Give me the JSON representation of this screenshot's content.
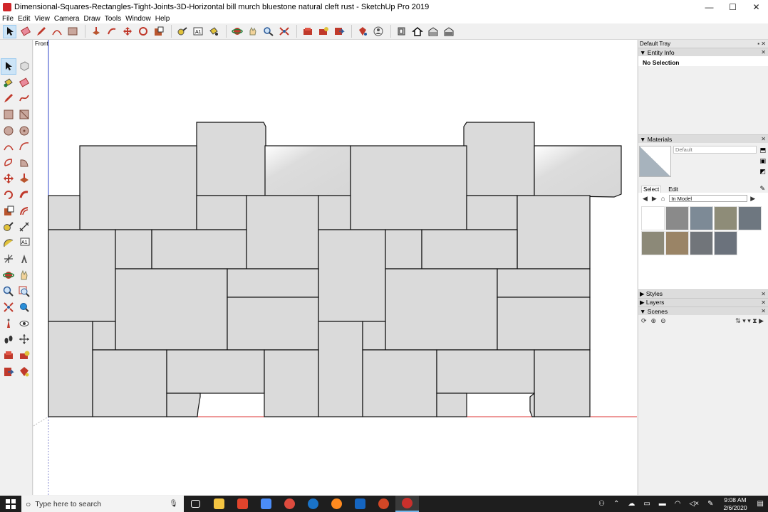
{
  "window": {
    "title": "Dimensional-Squares-Rectangles-Tight-Joints-3D-Horizontal bill murch bluestone natural cleft rust - SketchUp Pro 2019",
    "minimize": "—",
    "maximize": "☐",
    "close": "✕"
  },
  "menu": [
    "File",
    "Edit",
    "View",
    "Camera",
    "Draw",
    "Tools",
    "Window",
    "Help"
  ],
  "toolbar_icons": [
    "select-icon",
    "eraser-icon",
    "pencil-icon",
    "arc-icon",
    "rectangle-icon",
    "push-pull-icon",
    "follow-me-icon",
    "move-icon",
    "rotate-icon",
    "scale-icon",
    "tape-measure-icon",
    "text-icon",
    "paint-bucket-icon",
    "orbit-icon",
    "pan-icon",
    "zoom-icon",
    "zoom-extents-icon",
    "warehouse-icon",
    "extension-icon",
    "send-icon",
    "ruby-icon",
    "account-icon",
    "top-view-icon",
    "home-view-icon",
    "front-view-icon",
    "right-view-icon"
  ],
  "viewport": {
    "scene_label": "Front"
  },
  "tray": {
    "title": "Default Tray",
    "entity_info": {
      "title": "Entity Info",
      "status": "No Selection"
    },
    "materials": {
      "title": "Materials",
      "current_name": "Default",
      "tabs": [
        "Select",
        "Edit"
      ],
      "collection": "In Model",
      "swatch_colors": [
        "#ffffff",
        "#8a8a8a",
        "#7d8a96",
        "#8e8c78",
        "#6e7780",
        "#8c8978",
        "#9a8466",
        "#71757a",
        "#6b727c"
      ]
    },
    "styles": {
      "title": "Styles"
    },
    "layers": {
      "title": "Layers"
    },
    "scenes": {
      "title": "Scenes"
    }
  },
  "taskbar": {
    "search_placeholder": "Type here to search",
    "time": "9:08 AM",
    "date": "2/6/2020",
    "apps": [
      {
        "name": "task-view",
        "color": "#ffffff"
      },
      {
        "name": "file-explorer",
        "color": "#f4c542"
      },
      {
        "name": "sketchup-red",
        "color": "#e0442c"
      },
      {
        "name": "drive",
        "color": "#4b8df8"
      },
      {
        "name": "chrome",
        "color": "#dd4b3e"
      },
      {
        "name": "edge",
        "color": "#1a73c8"
      },
      {
        "name": "firefox",
        "color": "#ff8a1f"
      },
      {
        "name": "outlook",
        "color": "#1565c0"
      },
      {
        "name": "powerpoint",
        "color": "#d24726"
      },
      {
        "name": "sketchup",
        "color": "#c9302c"
      }
    ]
  }
}
